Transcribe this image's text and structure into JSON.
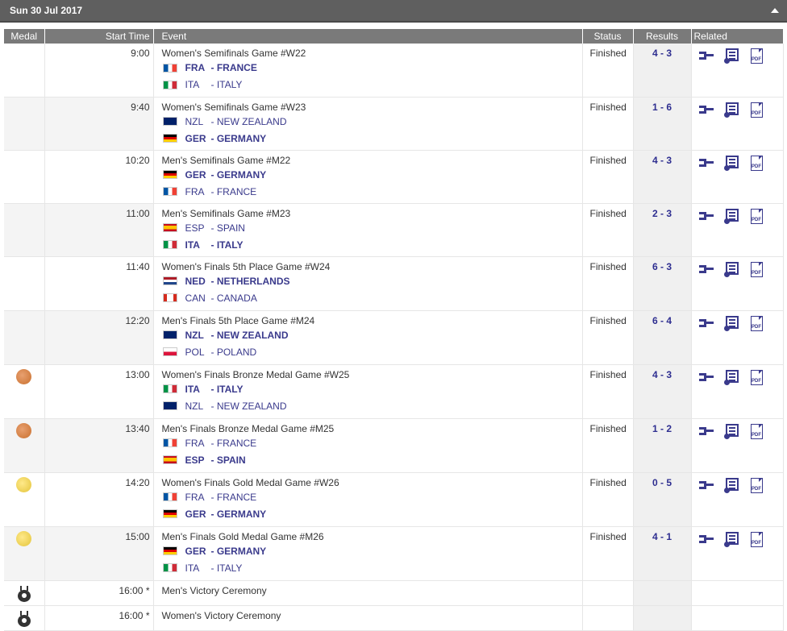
{
  "header": {
    "date": "Sun 30 Jul 2017"
  },
  "columns": {
    "medal": "Medal",
    "start_time": "Start Time",
    "event": "Event",
    "status": "Status",
    "results": "Results",
    "related": "Related"
  },
  "related_icons": [
    "bracket-icon",
    "results-list-icon",
    "pdf-icon"
  ],
  "pdf_label": "PDF",
  "colors": {
    "header_bg": "#5f5f5f",
    "column_header_bg": "#7a7a7a",
    "link": "#3a3a8c",
    "bronze": "#cf7a3a",
    "gold": "#f1d34f"
  },
  "rows": [
    {
      "time": "9:00",
      "medal": "",
      "event": "Women's Semifinals Game #W22",
      "status": "Finished",
      "result": "4 - 3",
      "team1": {
        "code": "FRA",
        "name": "- FRANCE",
        "win": true,
        "flag": "fra"
      },
      "team2": {
        "code": "ITA",
        "name": "- ITALY",
        "win": false,
        "flag": "ita"
      }
    },
    {
      "time": "9:40",
      "medal": "",
      "event": "Women's Semifinals Game #W23",
      "status": "Finished",
      "result": "1 - 6",
      "team1": {
        "code": "NZL",
        "name": "- NEW ZEALAND",
        "win": false,
        "flag": "nzl"
      },
      "team2": {
        "code": "GER",
        "name": "- GERMANY",
        "win": true,
        "flag": "ger"
      }
    },
    {
      "time": "10:20",
      "medal": "",
      "event": "Men's Semifinals Game #M22",
      "status": "Finished",
      "result": "4 - 3",
      "team1": {
        "code": "GER",
        "name": "- GERMANY",
        "win": true,
        "flag": "ger"
      },
      "team2": {
        "code": "FRA",
        "name": "- FRANCE",
        "win": false,
        "flag": "fra"
      }
    },
    {
      "time": "11:00",
      "medal": "",
      "event": "Men's Semifinals Game #M23",
      "status": "Finished",
      "result": "2 - 3",
      "team1": {
        "code": "ESP",
        "name": "- SPAIN",
        "win": false,
        "flag": "esp"
      },
      "team2": {
        "code": "ITA",
        "name": "- ITALY",
        "win": true,
        "flag": "ita"
      }
    },
    {
      "time": "11:40",
      "medal": "",
      "event": "Women's Finals 5th Place Game #W24",
      "status": "Finished",
      "result": "6 - 3",
      "team1": {
        "code": "NED",
        "name": "- NETHERLANDS",
        "win": true,
        "flag": "ned"
      },
      "team2": {
        "code": "CAN",
        "name": "- CANADA",
        "win": false,
        "flag": "can"
      }
    },
    {
      "time": "12:20",
      "medal": "",
      "event": "Men's Finals 5th Place Game #M24",
      "status": "Finished",
      "result": "6 - 4",
      "team1": {
        "code": "NZL",
        "name": "- NEW ZEALAND",
        "win": true,
        "flag": "nzl"
      },
      "team2": {
        "code": "POL",
        "name": "- POLAND",
        "win": false,
        "flag": "pol"
      }
    },
    {
      "time": "13:00",
      "medal": "bronze",
      "event": "Women's Finals Bronze Medal Game #W25",
      "status": "Finished",
      "result": "4 - 3",
      "team1": {
        "code": "ITA",
        "name": "- ITALY",
        "win": true,
        "flag": "ita"
      },
      "team2": {
        "code": "NZL",
        "name": "- NEW ZEALAND",
        "win": false,
        "flag": "nzl"
      }
    },
    {
      "time": "13:40",
      "medal": "bronze",
      "event": "Men's Finals Bronze Medal Game #M25",
      "status": "Finished",
      "result": "1 - 2",
      "team1": {
        "code": "FRA",
        "name": "- FRANCE",
        "win": false,
        "flag": "fra"
      },
      "team2": {
        "code": "ESP",
        "name": "- SPAIN",
        "win": true,
        "flag": "esp"
      }
    },
    {
      "time": "14:20",
      "medal": "gold",
      "event": "Women's Finals Gold Medal Game #W26",
      "status": "Finished",
      "result": "0 - 5",
      "team1": {
        "code": "FRA",
        "name": "- FRANCE",
        "win": false,
        "flag": "fra"
      },
      "team2": {
        "code": "GER",
        "name": "- GERMANY",
        "win": true,
        "flag": "ger"
      }
    },
    {
      "time": "15:00",
      "medal": "gold",
      "event": "Men's Finals Gold Medal Game #M26",
      "status": "Finished",
      "result": "4 - 1",
      "team1": {
        "code": "GER",
        "name": "- GERMANY",
        "win": true,
        "flag": "ger"
      },
      "team2": {
        "code": "ITA",
        "name": "- ITALY",
        "win": false,
        "flag": "ita"
      }
    }
  ],
  "ceremonies": [
    {
      "time": "16:00 *",
      "event": "Men's Victory Ceremony",
      "icon": "victory-ceremony-icon"
    },
    {
      "time": "16:00 *",
      "event": "Women's Victory Ceremony",
      "icon": "victory-ceremony-icon"
    }
  ]
}
